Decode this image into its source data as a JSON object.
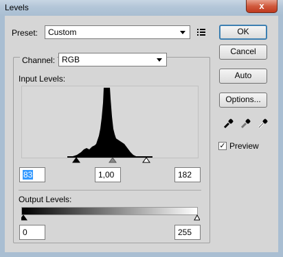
{
  "window": {
    "title": "Levels",
    "close_glyph": "x"
  },
  "preset": {
    "label": "Preset:",
    "value": "Custom",
    "menu_icon": "list-icon"
  },
  "channel": {
    "label": "Channel:",
    "value": "RGB"
  },
  "input_levels": {
    "label": "Input Levels:",
    "black": "83",
    "gamma": "1,00",
    "white": "182",
    "black_level": 83,
    "gamma_level": 1.0,
    "white_level": 182
  },
  "output_levels": {
    "label": "Output Levels:",
    "black": "0",
    "white": "255",
    "black_level": 0,
    "white_level": 255
  },
  "buttons": {
    "ok": "OK",
    "cancel": "Cancel",
    "auto": "Auto",
    "options": "Options..."
  },
  "eyedroppers": [
    "black-eyedropper-icon",
    "gray-eyedropper-icon",
    "white-eyedropper-icon"
  ],
  "preview": {
    "label": "Preview",
    "checked": true
  },
  "colors": {
    "accent": "#3c7fb1",
    "titlebar": "#b3c6d8",
    "close": "#c0391e"
  }
}
